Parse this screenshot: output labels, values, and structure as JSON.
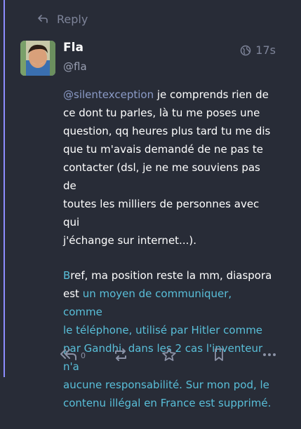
{
  "reply_bar": {
    "label": "Reply"
  },
  "post": {
    "display_name": "Fla",
    "handle": "@fla",
    "time": "17s",
    "p1_mention": "@silentexception",
    "p1_lines": [
      " je comprends rien de",
      "ce dont tu parles, là tu me poses une",
      "question, qq heures plus tard tu me dis",
      "que tu m'avais demandé de ne pas te",
      "contacter (dsl, je ne me souviens pas de",
      "toutes les milliers de personnes avec qui",
      "j'échange sur internet...)."
    ],
    "p2_first_letter": "B",
    "p2_start": "ref, ma position reste la mm, diaspora",
    "p2_est": "est ",
    "p2_link_lines": [
      "un moyen de communiquer, comme",
      "le téléphone, utilisé par Hitler comme",
      "par Gandhi, dans les 2 cas l'inventeur n'a",
      "aucune responsabilité. Sur mon pod, le",
      "contenu illégal en France est supprimé."
    ]
  },
  "actions": {
    "reply_count": "0"
  },
  "colors": {
    "background": "#282c37",
    "accent": "#8c8dff",
    "link": "#59bfd9",
    "muted": "#7e8499"
  }
}
